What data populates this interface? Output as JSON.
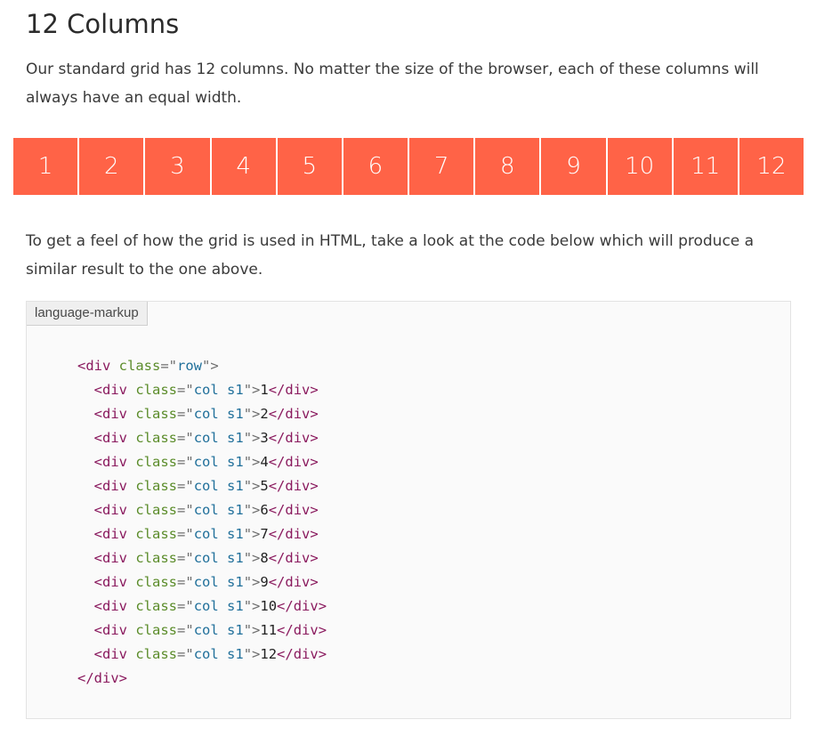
{
  "section": {
    "title": "12 Columns",
    "intro": "Our standard grid has 12 columns. No matter the size of the browser, each of these columns will always have an equal width.",
    "followup": "To get a feel of how the grid is used in HTML, take a look at the code below which will produce a similar result to the one above."
  },
  "grid": {
    "columns": [
      "1",
      "2",
      "3",
      "4",
      "5",
      "6",
      "7",
      "8",
      "9",
      "10",
      "11",
      "12"
    ],
    "accent_color": "#ff6347"
  },
  "code": {
    "language_label": "language-markup",
    "lines": [
      {
        "indent": "",
        "open": "<div",
        "attr": "class",
        "eq": "=\"",
        "value": "row",
        "close": "\">",
        "content": "",
        "end": ""
      },
      {
        "indent": "  ",
        "open": "<div",
        "attr": "class",
        "eq": "=\"",
        "value": "col s1",
        "close": "\">",
        "content": "1",
        "end": "</div>"
      },
      {
        "indent": "  ",
        "open": "<div",
        "attr": "class",
        "eq": "=\"",
        "value": "col s1",
        "close": "\">",
        "content": "2",
        "end": "</div>"
      },
      {
        "indent": "  ",
        "open": "<div",
        "attr": "class",
        "eq": "=\"",
        "value": "col s1",
        "close": "\">",
        "content": "3",
        "end": "</div>"
      },
      {
        "indent": "  ",
        "open": "<div",
        "attr": "class",
        "eq": "=\"",
        "value": "col s1",
        "close": "\">",
        "content": "4",
        "end": "</div>"
      },
      {
        "indent": "  ",
        "open": "<div",
        "attr": "class",
        "eq": "=\"",
        "value": "col s1",
        "close": "\">",
        "content": "5",
        "end": "</div>"
      },
      {
        "indent": "  ",
        "open": "<div",
        "attr": "class",
        "eq": "=\"",
        "value": "col s1",
        "close": "\">",
        "content": "6",
        "end": "</div>"
      },
      {
        "indent": "  ",
        "open": "<div",
        "attr": "class",
        "eq": "=\"",
        "value": "col s1",
        "close": "\">",
        "content": "7",
        "end": "</div>"
      },
      {
        "indent": "  ",
        "open": "<div",
        "attr": "class",
        "eq": "=\"",
        "value": "col s1",
        "close": "\">",
        "content": "8",
        "end": "</div>"
      },
      {
        "indent": "  ",
        "open": "<div",
        "attr": "class",
        "eq": "=\"",
        "value": "col s1",
        "close": "\">",
        "content": "9",
        "end": "</div>"
      },
      {
        "indent": "  ",
        "open": "<div",
        "attr": "class",
        "eq": "=\"",
        "value": "col s1",
        "close": "\">",
        "content": "10",
        "end": "</div>"
      },
      {
        "indent": "  ",
        "open": "<div",
        "attr": "class",
        "eq": "=\"",
        "value": "col s1",
        "close": "\">",
        "content": "11",
        "end": "</div>"
      },
      {
        "indent": "  ",
        "open": "<div",
        "attr": "class",
        "eq": "=\"",
        "value": "col s1",
        "close": "\">",
        "content": "12",
        "end": "</div>"
      },
      {
        "indent": "",
        "open": "</div>",
        "attr": "",
        "eq": "",
        "value": "",
        "close": "",
        "content": "",
        "end": ""
      }
    ]
  }
}
